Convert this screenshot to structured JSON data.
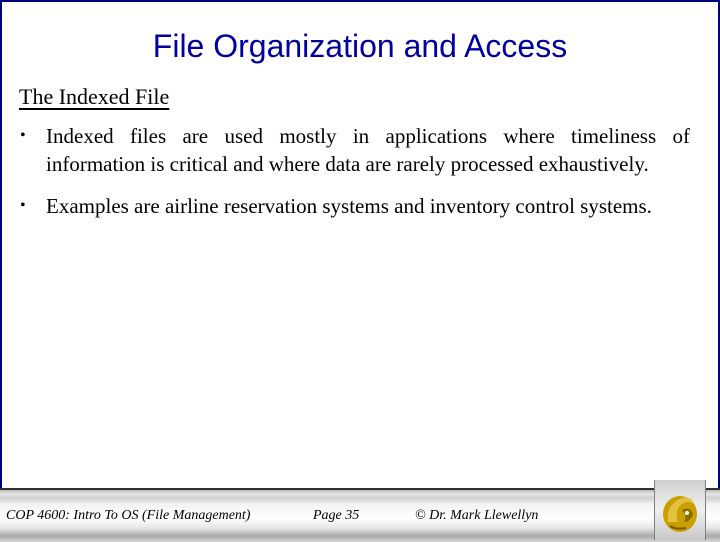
{
  "slide": {
    "title": "File Organization and Access",
    "subtitle": "The Indexed File",
    "bullets": [
      "Indexed files are used mostly in applications where timeliness of information is critical and where data are rarely processed exhaustively.",
      "Examples are airline reservation systems and inventory control systems."
    ],
    "bullet_glyph": "•"
  },
  "footer": {
    "course": "COP 4600: Intro To OS  (File Management)",
    "page": "Page 35",
    "copyright": "© Dr. Mark Llewellyn",
    "logo_icon": "ucf-pegasus-logo-icon"
  },
  "colors": {
    "title": "#0000a0",
    "border": "#000080",
    "logo_gold": "#c9a000"
  }
}
